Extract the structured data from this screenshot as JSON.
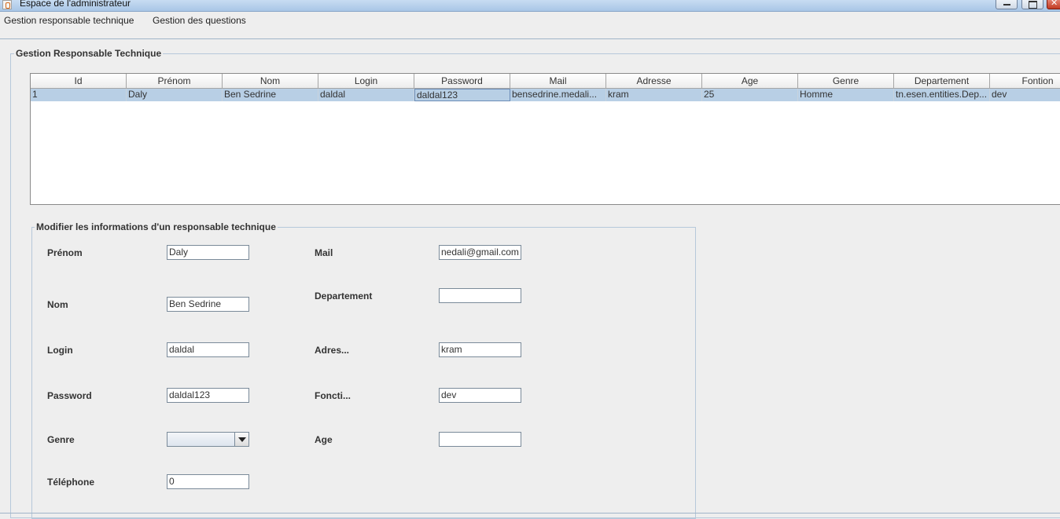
{
  "window": {
    "title": "Espace de l'administrateur"
  },
  "menu": {
    "items": [
      "Gestion responsable technique",
      "Gestion des questions"
    ]
  },
  "outer_panel": {
    "title": "Gestion Responsable Technique"
  },
  "table": {
    "columns": [
      "Id",
      "Prénom",
      "Nom",
      "Login",
      "Password",
      "Mail",
      "Adresse",
      "Age",
      "Genre",
      "Departement",
      "Fontion"
    ],
    "rows": [
      [
        "1",
        "Daly",
        "Ben Sedrine",
        "daldal",
        "daldal123",
        "bensedrine.medali...",
        "kram",
        "25",
        "Homme",
        "tn.esen.entities.Dep...",
        "dev"
      ]
    ]
  },
  "form": {
    "title": "Modifier les informations d'un responsable technique",
    "prenom": {
      "label": "Prénom",
      "value": "Daly"
    },
    "nom": {
      "label": "Nom",
      "value": "Ben Sedrine"
    },
    "login": {
      "label": "Login",
      "value": "daldal"
    },
    "password": {
      "label": "Password",
      "value": "daldal123"
    },
    "genre": {
      "label": "Genre",
      "value": ""
    },
    "telephone": {
      "label": "Téléphone",
      "value": "0"
    },
    "mail": {
      "label": "Mail",
      "value": "nedali@gmail.com"
    },
    "departement": {
      "label": "Departement",
      "value": ""
    },
    "adresse": {
      "label": "Adres...",
      "value": "kram"
    },
    "fonction": {
      "label": "Foncti...",
      "value": "dev"
    },
    "age": {
      "label": "Age",
      "value": ""
    }
  }
}
